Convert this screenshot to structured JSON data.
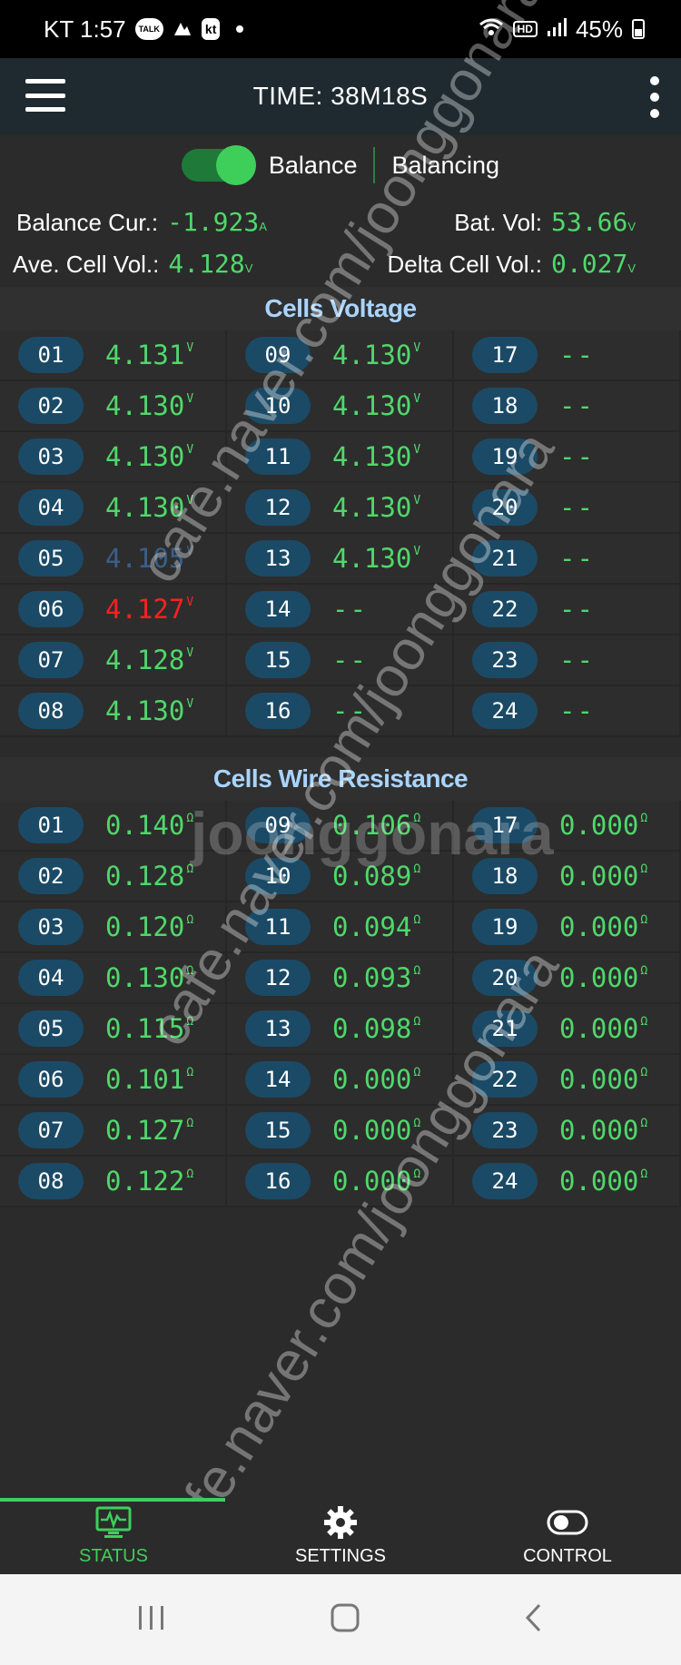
{
  "status_bar": {
    "carrier_time": "KT 1:57",
    "talk": "TALK",
    "kt": "kt",
    "hd": "HD",
    "battery": "45%"
  },
  "app_bar": {
    "title": "TIME: 38M18S"
  },
  "balance": {
    "label": "Balance",
    "state": "Balancing",
    "enabled": true
  },
  "summary": {
    "balance_cur_label": "Balance Cur.:",
    "balance_cur_value": "-1.923",
    "balance_cur_unit": "A",
    "bat_vol_label": "Bat. Vol:",
    "bat_vol_value": "53.66",
    "bat_vol_unit": "V",
    "ave_cell_label": "Ave. Cell Vol.:",
    "ave_cell_value": "4.128",
    "ave_cell_unit": "V",
    "delta_cell_label": "Delta Cell Vol.:",
    "delta_cell_value": "0.027",
    "delta_cell_unit": "V"
  },
  "cells_voltage": {
    "title": "Cells Voltage",
    "unit": "V",
    "cells": [
      {
        "id": "01",
        "value": "4.131",
        "style": "normal"
      },
      {
        "id": "02",
        "value": "4.130",
        "style": "normal"
      },
      {
        "id": "03",
        "value": "4.130",
        "style": "normal"
      },
      {
        "id": "04",
        "value": "4.130",
        "style": "normal"
      },
      {
        "id": "05",
        "value": "4.105",
        "style": "dim"
      },
      {
        "id": "06",
        "value": "4.127",
        "style": "red"
      },
      {
        "id": "07",
        "value": "4.128",
        "style": "normal"
      },
      {
        "id": "08",
        "value": "4.130",
        "style": "normal"
      },
      {
        "id": "09",
        "value": "4.130",
        "style": "normal"
      },
      {
        "id": "10",
        "value": "4.130",
        "style": "normal"
      },
      {
        "id": "11",
        "value": "4.130",
        "style": "normal"
      },
      {
        "id": "12",
        "value": "4.130",
        "style": "normal"
      },
      {
        "id": "13",
        "value": "4.130",
        "style": "normal"
      },
      {
        "id": "14",
        "value": "--",
        "style": "empty"
      },
      {
        "id": "15",
        "value": "--",
        "style": "empty"
      },
      {
        "id": "16",
        "value": "--",
        "style": "empty"
      },
      {
        "id": "17",
        "value": "--",
        "style": "empty"
      },
      {
        "id": "18",
        "value": "--",
        "style": "empty"
      },
      {
        "id": "19",
        "value": "--",
        "style": "empty"
      },
      {
        "id": "20",
        "value": "--",
        "style": "empty"
      },
      {
        "id": "21",
        "value": "--",
        "style": "empty"
      },
      {
        "id": "22",
        "value": "--",
        "style": "empty"
      },
      {
        "id": "23",
        "value": "--",
        "style": "empty"
      },
      {
        "id": "24",
        "value": "--",
        "style": "empty"
      }
    ]
  },
  "cells_resistance": {
    "title": "Cells Wire Resistance",
    "unit": "Ω",
    "cells": [
      {
        "id": "01",
        "value": "0.140"
      },
      {
        "id": "02",
        "value": "0.128"
      },
      {
        "id": "03",
        "value": "0.120"
      },
      {
        "id": "04",
        "value": "0.130"
      },
      {
        "id": "05",
        "value": "0.115"
      },
      {
        "id": "06",
        "value": "0.101"
      },
      {
        "id": "07",
        "value": "0.127"
      },
      {
        "id": "08",
        "value": "0.122"
      },
      {
        "id": "09",
        "value": "0.106"
      },
      {
        "id": "10",
        "value": "0.089"
      },
      {
        "id": "11",
        "value": "0.094"
      },
      {
        "id": "12",
        "value": "0.093"
      },
      {
        "id": "13",
        "value": "0.098"
      },
      {
        "id": "14",
        "value": "0.000"
      },
      {
        "id": "15",
        "value": "0.000"
      },
      {
        "id": "16",
        "value": "0.000"
      },
      {
        "id": "17",
        "value": "0.000"
      },
      {
        "id": "18",
        "value": "0.000"
      },
      {
        "id": "19",
        "value": "0.000"
      },
      {
        "id": "20",
        "value": "0.000"
      },
      {
        "id": "21",
        "value": "0.000"
      },
      {
        "id": "22",
        "value": "0.000"
      },
      {
        "id": "23",
        "value": "0.000"
      },
      {
        "id": "24",
        "value": "0.000"
      }
    ]
  },
  "bottom_nav": {
    "items": [
      {
        "label": "STATUS",
        "active": true
      },
      {
        "label": "SETTINGS"
      },
      {
        "label": "CONTROL"
      }
    ]
  },
  "watermark": {
    "text": "cafe.naver.com/joonggonara",
    "logo_text": "joonggonara"
  },
  "colors": {
    "accent_green": "#3ecf5b",
    "value_green": "#4fd86a",
    "pill_blue": "#1b4a66",
    "title_blue": "#a9d4ff",
    "warn_red": "#ff2020"
  }
}
